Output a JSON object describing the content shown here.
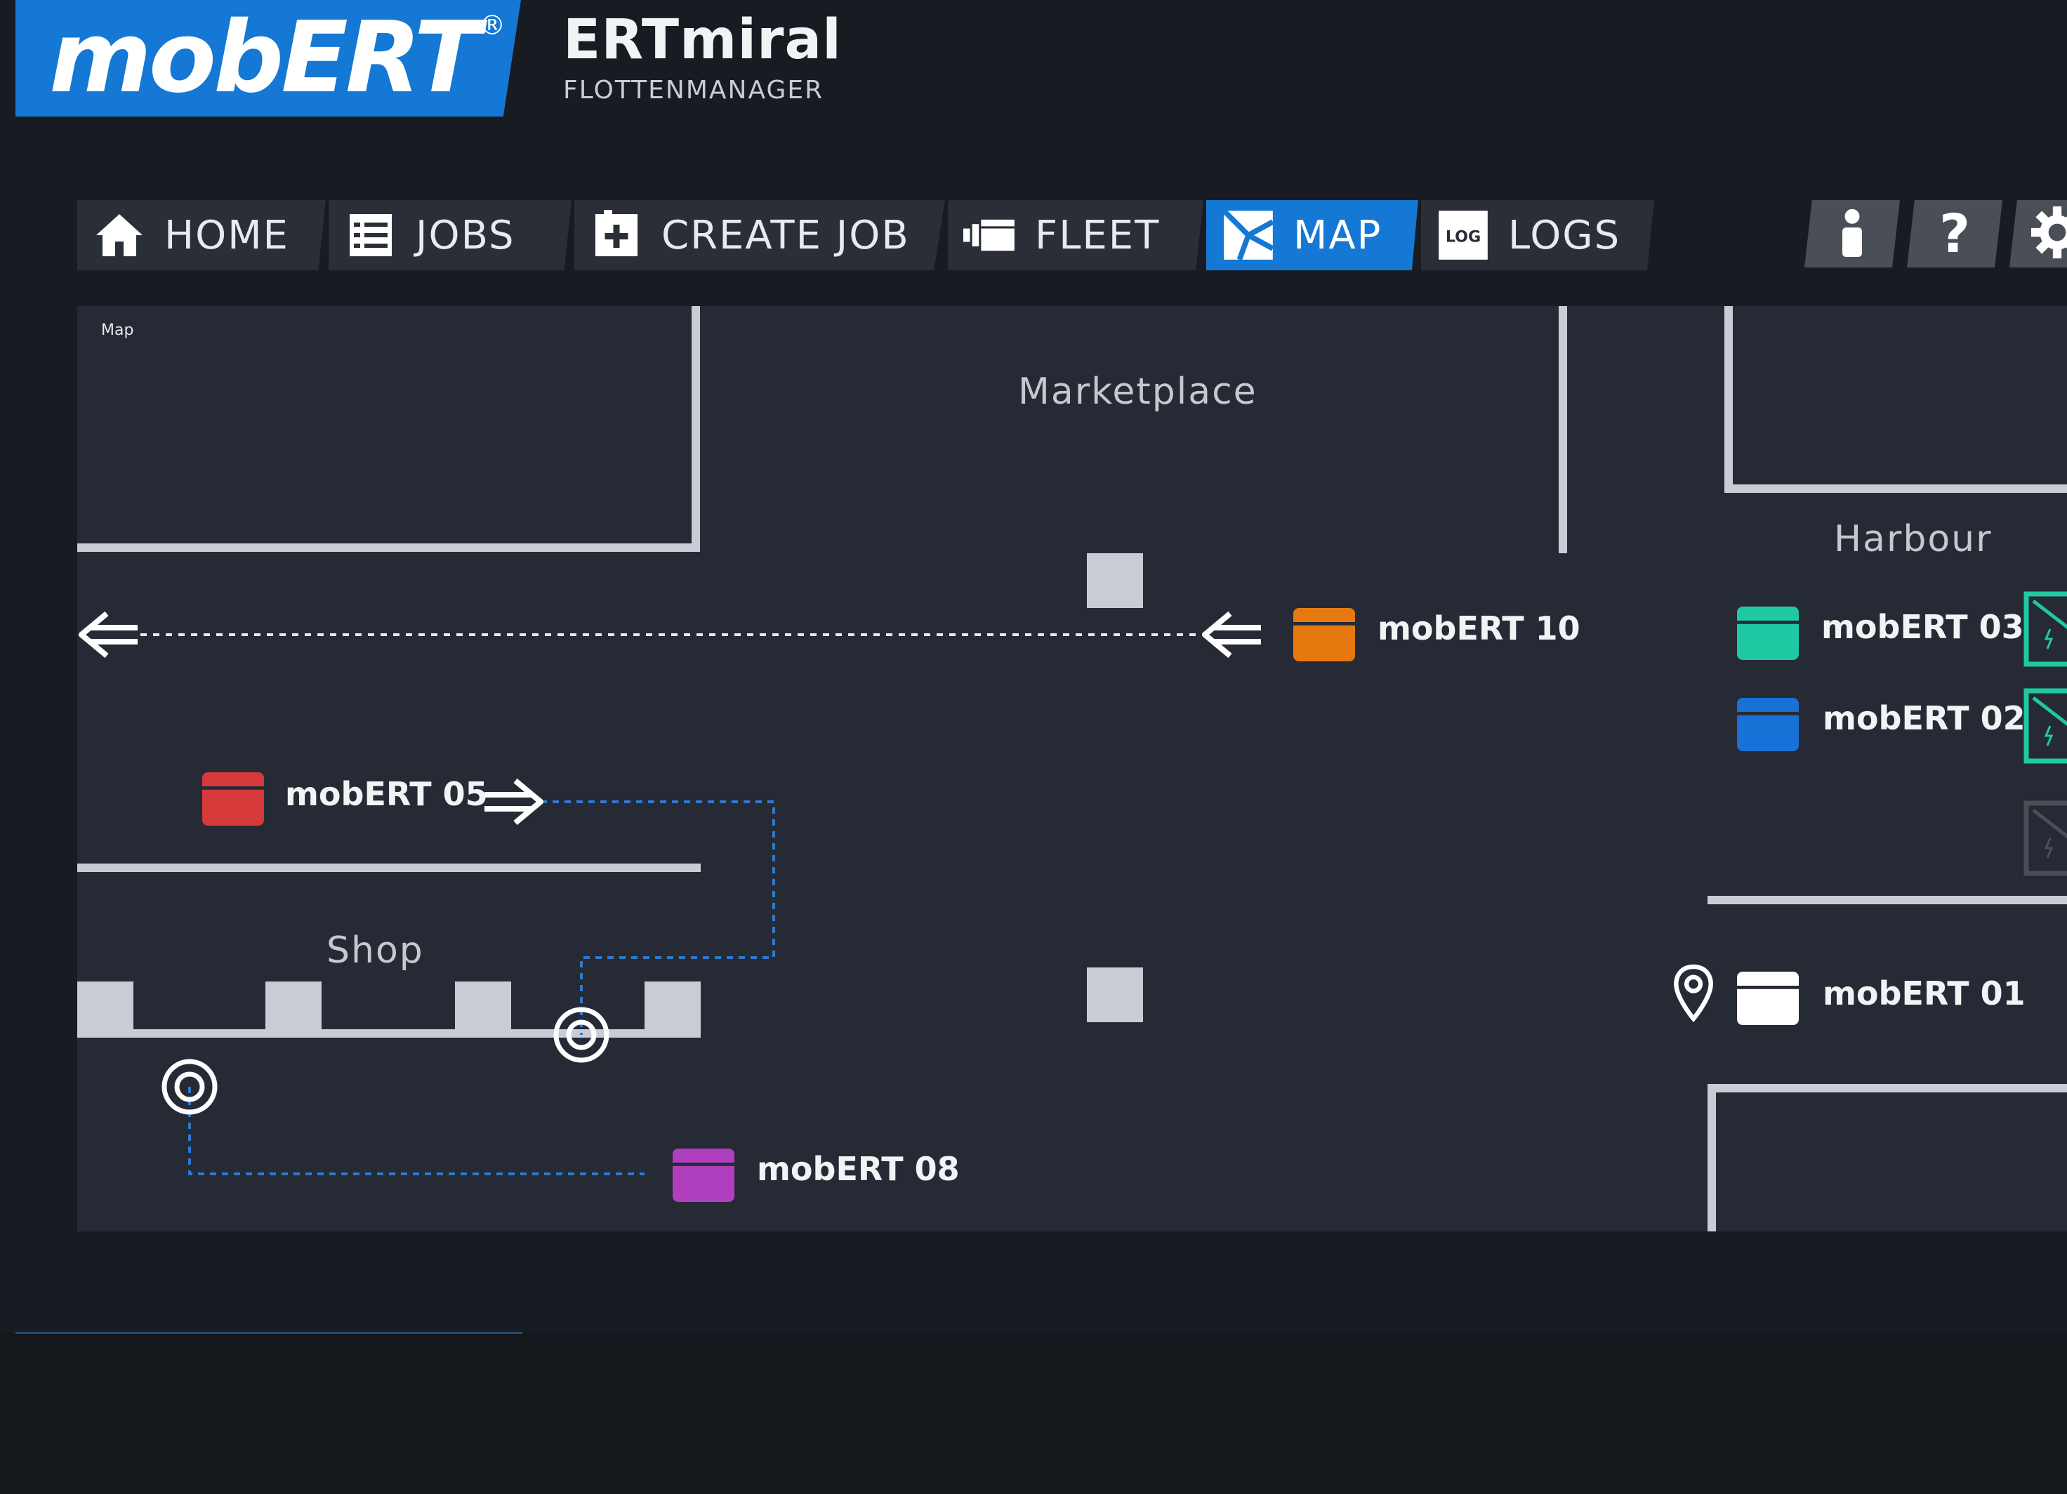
{
  "header": {
    "logo_text": "mobERT",
    "logo_reg": "®",
    "app_title": "ERTmiral",
    "app_subtitle": "FLOTTENMANAGER"
  },
  "nav": {
    "tabs": [
      {
        "label": "HOME",
        "icon": "home-icon",
        "active": false
      },
      {
        "label": "JOBS",
        "icon": "list-icon",
        "active": false
      },
      {
        "label": "CREATE JOB",
        "icon": "add-job-icon",
        "active": false
      },
      {
        "label": "FLEET",
        "icon": "fleet-icon",
        "active": false
      },
      {
        "label": "MAP",
        "icon": "map-icon",
        "active": true
      },
      {
        "label": "LOGS",
        "icon": "log-icon",
        "active": false
      }
    ],
    "log_badge": "LOG",
    "tools": [
      {
        "icon": "user-icon"
      },
      {
        "icon": "help-icon"
      },
      {
        "icon": "settings-icon"
      }
    ]
  },
  "map": {
    "caption": "Map",
    "areas": {
      "marketplace": "Marketplace",
      "harbour": "Harbour",
      "shop": "Shop"
    },
    "robots": {
      "r10": {
        "label": "mobERT 10",
        "color": "#e5790f"
      },
      "r03": {
        "label": "mobERT 03",
        "color": "#1ec9a4"
      },
      "r02": {
        "label": "mobERT 02",
        "color": "#1771d6"
      },
      "r05": {
        "label": "mobERT 05",
        "color": "#d63a3a"
      },
      "r01": {
        "label": "mobERT 01",
        "color": "#ffffff"
      },
      "r08": {
        "label": "mobERT 08",
        "color": "#b03fbf"
      }
    },
    "colors": {
      "accent": "#1478d4",
      "path": "#2e7ad0",
      "charger": "#1ec9a4",
      "wall": "#c8ccd4"
    }
  }
}
